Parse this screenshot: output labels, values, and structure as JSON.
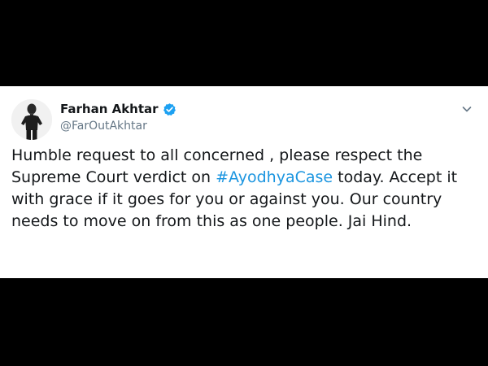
{
  "author": {
    "display_name": "Farhan Akhtar",
    "handle": "@FarOutAkhtar",
    "verified": true
  },
  "icons": {
    "verified": "verified-badge-icon",
    "menu": "chevron-down-icon",
    "avatar": "profile-photo"
  },
  "tweet": {
    "text_before": "Humble request to all concerned , please respect the Supreme Court verdict on ",
    "hashtag": "#AyodhyaCase",
    "text_after": " today. Accept it with grace if it goes for you or against you. Our country needs to move on from this as one people. Jai Hind."
  },
  "colors": {
    "background": "#000000",
    "card": "#ffffff",
    "text": "#14171a",
    "secondary": "#657786",
    "accent": "#1b95e0",
    "verified": "#1da1f2"
  }
}
